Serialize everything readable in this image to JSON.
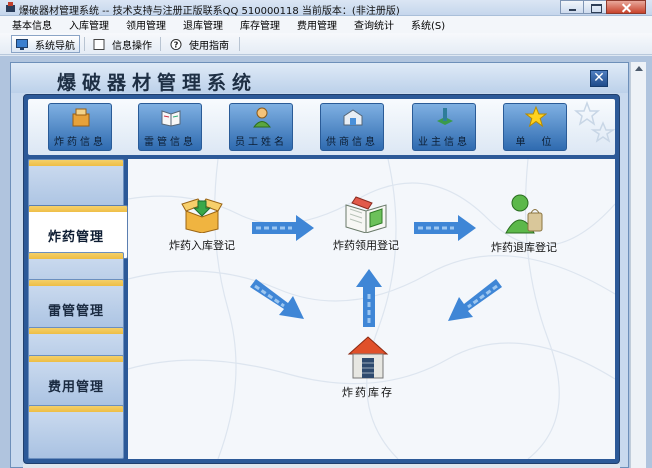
{
  "window": {
    "title": "爆破器材管理系统 -- 技术支持与注册正版联系QQ 510000118    当前版本：(非注册版)"
  },
  "menu": [
    "基本信息",
    "入库管理",
    "领用管理",
    "退库管理",
    "库存管理",
    "费用管理",
    "查询统计",
    "系统(S)"
  ],
  "toolbar": {
    "items": [
      {
        "label": "系统导航",
        "icon": "monitor-icon"
      },
      {
        "label": "信息操作",
        "icon": "checkbox-icon"
      },
      {
        "label": "使用指南",
        "icon": "help-icon"
      }
    ]
  },
  "child": {
    "title": "爆破器材管理系统",
    "close": "✕"
  },
  "top_buttons": [
    {
      "label": "炸药信息",
      "icon": "explosive-info-icon"
    },
    {
      "label": "雷管信息",
      "icon": "detonator-book-icon"
    },
    {
      "label": "员工姓名",
      "icon": "employee-icon"
    },
    {
      "label": "供商信息",
      "icon": "supplier-icon"
    },
    {
      "label": "业主信息",
      "icon": "owner-icon"
    },
    {
      "label": "单　位",
      "icon": "star-icon"
    }
  ],
  "left_tabs": [
    {
      "label": "",
      "active": false
    },
    {
      "label": "炸药管理",
      "active": true
    },
    {
      "label": "",
      "active": false
    },
    {
      "label": "雷管管理",
      "active": false
    },
    {
      "label": "",
      "active": false
    },
    {
      "label": "费用管理",
      "active": false
    }
  ],
  "flow": {
    "inbound": "炸药入库登记",
    "issue": "炸药领用登记",
    "return": "炸药退库登记",
    "stock": "炸药库存"
  },
  "colors": {
    "panel": "#2c5998",
    "tab_accent": "#efbf47",
    "arrow": "#3f86d6"
  }
}
